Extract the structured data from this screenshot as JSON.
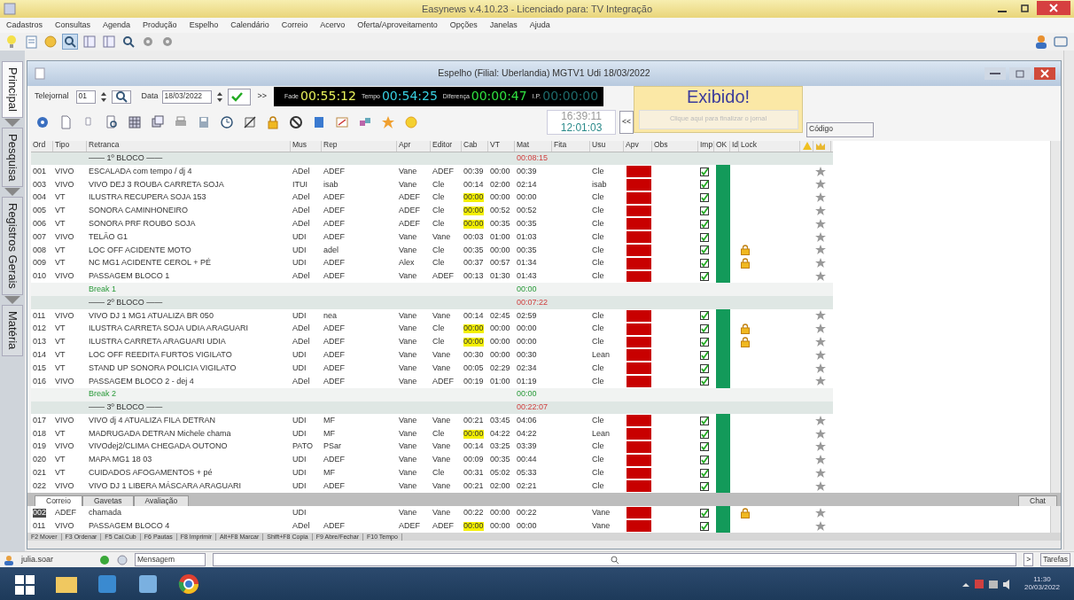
{
  "app": {
    "title": "Easynews v.4.10.23 - Licenciado para: TV Integração"
  },
  "menu": [
    "Cadastros",
    "Consultas",
    "Agenda",
    "Produção",
    "Espelho",
    "Calendário",
    "Correio",
    "Acervo",
    "Oferta/Aproveitamento",
    "Opções",
    "Janelas",
    "Ajuda"
  ],
  "side_tabs": [
    {
      "label": "Principal",
      "selected": true
    },
    {
      "label": "Pesquisa",
      "selected": false
    },
    {
      "label": "Registros Gerais",
      "selected": false
    },
    {
      "label": "Matéria",
      "selected": false
    }
  ],
  "espelho": {
    "title": "Espelho (Filial: Uberlandia)  MGTV1 Udi  18/03/2022",
    "telejornal_label": "Telejornal",
    "telejornal": "01",
    "data_label": "Data",
    "data": "18/03/2022",
    "next": ">>",
    "timers": [
      {
        "kind": "fade",
        "label": "Fade",
        "value": "00:55:12"
      },
      {
        "kind": "tempo",
        "label": "Tempo",
        "value": "00:54:25"
      },
      {
        "kind": "diff",
        "label": "Diferença",
        "value": "00:00:47"
      },
      {
        "kind": "ip",
        "label": "I.P.",
        "value": "00:00:00"
      }
    ],
    "clock": [
      "16:39:11",
      "12:01:03"
    ],
    "back": "<<",
    "status": "Exibido!",
    "finish_button": "Clique aqui para finalizar o jornal",
    "codigo": "Código"
  },
  "columns": [
    "Ord",
    "Tipo",
    "Retranca",
    "Mus",
    "Rep",
    "Apr",
    "Editor",
    "Cab",
    "VT",
    "Mat",
    "Fita",
    "Usu",
    "Apv",
    "Obs",
    "Imp",
    "OK",
    "Id",
    "Lock"
  ],
  "rows": [
    {
      "kind": "block",
      "retranca": "—— 1º BLOCO ——",
      "mat": "00:08:15"
    },
    {
      "kind": "item",
      "ord": "001",
      "tipo": "VIVO",
      "retranca": "ESCALADA com tempo / dj 4",
      "mus": "ADel",
      "rep": "ADEF",
      "apr": "Vane",
      "editor": "ADEF",
      "cab": "00:39",
      "cab_alert": false,
      "vt": "00:00",
      "mat": "00:39",
      "usu": "Cle",
      "approved": false,
      "imp": true,
      "ok": true,
      "lock": false
    },
    {
      "kind": "item",
      "ord": "003",
      "tipo": "VIVO",
      "retranca": "VIVO DEJ 3 ROUBA CARRETA SOJA",
      "mus": "ITUI",
      "rep": "isab",
      "apr": "Vane",
      "editor": "Cle",
      "cab": "00:14",
      "cab_alert": false,
      "vt": "02:00",
      "mat": "02:14",
      "usu": "isab",
      "approved": false,
      "imp": true,
      "ok": true,
      "lock": false
    },
    {
      "kind": "item",
      "ord": "004",
      "tipo": "VT",
      "retranca": "ILUSTRA RECUPERA SOJA 153",
      "mus": "ADel",
      "rep": "ADEF",
      "apr": "ADEF",
      "editor": "Cle",
      "cab": "00:00",
      "cab_alert": true,
      "vt": "00:00",
      "mat": "00:00",
      "usu": "Cle",
      "approved": false,
      "imp": true,
      "ok": true,
      "lock": false
    },
    {
      "kind": "item",
      "ord": "005",
      "tipo": "VT",
      "retranca": "SONORA CAMINHONEIRO",
      "mus": "ADel",
      "rep": "ADEF",
      "apr": "ADEF",
      "editor": "Cle",
      "cab": "00:00",
      "cab_alert": true,
      "vt": "00:52",
      "mat": "00:52",
      "usu": "Cle",
      "approved": false,
      "imp": true,
      "ok": true,
      "lock": false
    },
    {
      "kind": "item",
      "ord": "006",
      "tipo": "VT",
      "retranca": "SONORA PRF ROUBO SOJA",
      "mus": "ADel",
      "rep": "ADEF",
      "apr": "ADEF",
      "editor": "Cle",
      "cab": "00:00",
      "cab_alert": true,
      "vt": "00:35",
      "mat": "00:35",
      "usu": "Cle",
      "approved": false,
      "imp": true,
      "ok": true,
      "lock": false
    },
    {
      "kind": "item",
      "ord": "007",
      "tipo": "VIVO",
      "retranca": "TELÃO G1",
      "mus": "UDI",
      "rep": "ADEF",
      "apr": "Vane",
      "editor": "Vane",
      "cab": "00:03",
      "cab_alert": false,
      "vt": "01:00",
      "mat": "01:03",
      "usu": "Cle",
      "approved": false,
      "imp": true,
      "ok": true,
      "lock": false
    },
    {
      "kind": "item",
      "ord": "008",
      "tipo": "VT",
      "retranca": "LOC OFF ACIDENTE MOTO",
      "mus": "UDI",
      "rep": "adel",
      "apr": "Vane",
      "editor": "Cle",
      "cab": "00:35",
      "cab_alert": false,
      "vt": "00:00",
      "mat": "00:35",
      "usu": "Cle",
      "approved": false,
      "imp": true,
      "ok": true,
      "lock": true
    },
    {
      "kind": "item",
      "ord": "009",
      "tipo": "VT",
      "retranca": "NC MG1 ACIDENTE CEROL + PÉ",
      "mus": "UDI",
      "rep": "ADEF",
      "apr": "Alex",
      "editor": "Cle",
      "cab": "00:37",
      "cab_alert": false,
      "vt": "00:57",
      "mat": "01:34",
      "usu": "Cle",
      "approved": false,
      "imp": true,
      "ok": true,
      "lock": true
    },
    {
      "kind": "item",
      "ord": "010",
      "tipo": "VIVO",
      "retranca": "PASSAGEM BLOCO 1",
      "mus": "ADel",
      "rep": "ADEF",
      "apr": "Vane",
      "editor": "ADEF",
      "cab": "00:13",
      "cab_alert": false,
      "vt": "01:30",
      "mat": "01:43",
      "usu": "Cle",
      "approved": false,
      "imp": true,
      "ok": true,
      "lock": false
    },
    {
      "kind": "break",
      "retranca": "Break 1",
      "mat": "00:00"
    },
    {
      "kind": "block",
      "retranca": "—— 2º BLOCO ——",
      "mat": "00:07:22"
    },
    {
      "kind": "item",
      "ord": "011",
      "tipo": "VIVO",
      "retranca": "VIVO DJ 1 MG1 ATUALIZA BR 050",
      "mus": "UDI",
      "rep": "nea",
      "apr": "Vane",
      "editor": "Vane",
      "cab": "00:14",
      "cab_alert": false,
      "vt": "02:45",
      "mat": "02:59",
      "usu": "Cle",
      "approved": false,
      "imp": true,
      "ok": true,
      "lock": false
    },
    {
      "kind": "item",
      "ord": "012",
      "tipo": "VT",
      "retranca": "ILUSTRA CARRETA SOJA UDIA  ARAGUARI",
      "mus": "ADel",
      "rep": "ADEF",
      "apr": "Vane",
      "editor": "Cle",
      "cab": "00:00",
      "cab_alert": true,
      "vt": "00:00",
      "mat": "00:00",
      "usu": "Cle",
      "approved": false,
      "imp": true,
      "ok": true,
      "lock": true
    },
    {
      "kind": "item",
      "ord": "013",
      "tipo": "VT",
      "retranca": "ILUSTRA  CARRETA ARAGUARI UDIA",
      "mus": "ADel",
      "rep": "ADEF",
      "apr": "Vane",
      "editor": "Cle",
      "cab": "00:00",
      "cab_alert": true,
      "vt": "00:00",
      "mat": "00:00",
      "usu": "Cle",
      "approved": false,
      "imp": true,
      "ok": true,
      "lock": true
    },
    {
      "kind": "item",
      "ord": "014",
      "tipo": "VT",
      "retranca": "LOC OFF REEDITA FURTOS VIGILATO",
      "mus": "UDI",
      "rep": "ADEF",
      "apr": "Vane",
      "editor": "Vane",
      "cab": "00:30",
      "cab_alert": false,
      "vt": "00:00",
      "mat": "00:30",
      "usu": "Lean",
      "approved": false,
      "imp": true,
      "ok": true,
      "lock": false
    },
    {
      "kind": "item",
      "ord": "015",
      "tipo": "VT",
      "retranca": "STAND UP SONORA POLICIA VIGILATO",
      "mus": "UDI",
      "rep": "ADEF",
      "apr": "Vane",
      "editor": "Vane",
      "cab": "00:05",
      "cab_alert": false,
      "vt": "02:29",
      "mat": "02:34",
      "usu": "Cle",
      "approved": false,
      "imp": true,
      "ok": true,
      "lock": false
    },
    {
      "kind": "item",
      "ord": "016",
      "tipo": "VIVO",
      "retranca": "PASSAGEM BLOCO 2 - dej 4",
      "mus": "ADel",
      "rep": "ADEF",
      "apr": "Vane",
      "editor": "ADEF",
      "cab": "00:19",
      "cab_alert": false,
      "vt": "01:00",
      "mat": "01:19",
      "usu": "Cle",
      "approved": false,
      "imp": true,
      "ok": true,
      "lock": false
    },
    {
      "kind": "break",
      "retranca": "Break 2",
      "mat": "00:00"
    },
    {
      "kind": "block",
      "retranca": "—— 3º BLOCO ——",
      "mat": "00:22:07"
    },
    {
      "kind": "item",
      "ord": "017",
      "tipo": "VIVO",
      "retranca": "VIVO dj 4 ATUALIZA FILA DETRAN",
      "mus": "UDI",
      "rep": "MF",
      "apr": "Vane",
      "editor": "Vane",
      "cab": "00:21",
      "cab_alert": false,
      "vt": "03:45",
      "mat": "04:06",
      "usu": "Cle",
      "approved": false,
      "imp": true,
      "ok": true,
      "lock": false
    },
    {
      "kind": "item",
      "ord": "018",
      "tipo": "VT",
      "retranca": "MADRUGADA DETRAN  Michele chama",
      "mus": "UDI",
      "rep": "MF",
      "apr": "Vane",
      "editor": "Cle",
      "cab": "00:00",
      "cab_alert": true,
      "vt": "04:22",
      "mat": "04:22",
      "usu": "Lean",
      "approved": false,
      "imp": true,
      "ok": true,
      "lock": false
    },
    {
      "kind": "item",
      "ord": "019",
      "tipo": "VIVO",
      "retranca": "VIVOdej2/CLIMA CHEGADA OUTONO",
      "mus": "PATO",
      "rep": "PSar",
      "apr": "Vane",
      "editor": "Vane",
      "cab": "00:14",
      "cab_alert": false,
      "vt": "03:25",
      "mat": "03:39",
      "usu": "Cle",
      "approved": false,
      "imp": true,
      "ok": true,
      "lock": false
    },
    {
      "kind": "item",
      "ord": "020",
      "tipo": "VT",
      "retranca": "MAPA MG1 18 03",
      "mus": "UDI",
      "rep": "ADEF",
      "apr": "Vane",
      "editor": "Vane",
      "cab": "00:09",
      "cab_alert": false,
      "vt": "00:35",
      "mat": "00:44",
      "usu": "Cle",
      "approved": false,
      "imp": true,
      "ok": true,
      "lock": false
    },
    {
      "kind": "item",
      "ord": "021",
      "tipo": "VT",
      "retranca": "CUIDADOS AFOGAMENTOS + pé",
      "mus": "UDI",
      "rep": "MF",
      "apr": "Vane",
      "editor": "Cle",
      "cab": "00:31",
      "cab_alert": false,
      "vt": "05:02",
      "mat": "05:33",
      "usu": "Cle",
      "approved": false,
      "imp": true,
      "ok": true,
      "lock": false
    },
    {
      "kind": "item",
      "ord": "022",
      "tipo": "VIVO",
      "retranca": "VIVO DJ 1 LIBERA MÁSCARA ARAGUARI",
      "mus": "UDI",
      "rep": "ADEF",
      "apr": "Vane",
      "editor": "Vane",
      "cab": "00:21",
      "cab_alert": false,
      "vt": "02:00",
      "mat": "02:21",
      "usu": "Cle",
      "approved": false,
      "imp": true,
      "ok": true,
      "lock": false
    }
  ],
  "bottom_tabs": [
    {
      "label": "Correio",
      "selected": true
    },
    {
      "label": "Gavetas",
      "selected": false
    },
    {
      "label": "Avaliação",
      "selected": false
    }
  ],
  "chat": "Chat",
  "bottom_rows": [
    {
      "kind": "item",
      "selected": true,
      "ord": "002",
      "tipo": "ADEF",
      "retranca": "chamada",
      "mus": "UDI",
      "apr": "Vane",
      "editor": "Vane",
      "cab": "00:22",
      "cab_alert": false,
      "vt": "00:00",
      "mat": "00:22",
      "usu": "Vane",
      "approved": false,
      "imp": true,
      "ok": true,
      "lock": true
    },
    {
      "kind": "item",
      "selected": false,
      "ord": "011",
      "tipo": "VIVO",
      "retranca": "PASSAGEM BLOCO 4",
      "mus": "ADel",
      "rep": "ADEF",
      "apr": "ADEF",
      "editor": "ADEF",
      "cab": "00:00",
      "cab_alert": true,
      "vt": "00:00",
      "mat": "00:00",
      "usu": "Vane",
      "approved": false,
      "imp": true,
      "ok": true,
      "lock": false
    }
  ],
  "shortcuts": [
    "F2 Mover",
    "F3 Ordenar",
    "F5 Cal.Cub",
    "F6 Pautas",
    "F8 Imprimir",
    "Alt+F8 Marcar",
    "Shift+F8 Copia",
    "F9 Abre/Fechar",
    "F10 Tempo"
  ],
  "status_bar": {
    "user": "julia.soar",
    "message": "Mensagem",
    "next": ">",
    "tasks": "Tarefas"
  },
  "taskbar": {
    "time": "11:30",
    "date": "20/03/2022"
  }
}
